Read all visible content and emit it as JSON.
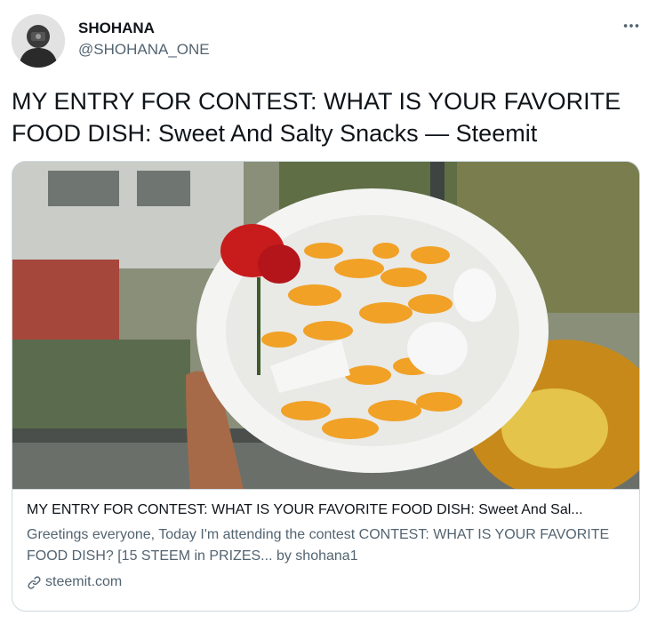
{
  "author": {
    "display_name": "SHOHANA",
    "handle": "@SHOHANA_ONE"
  },
  "tweet": {
    "text": "MY ENTRY FOR CONTEST: WHAT IS YOUR FAVORITE FOOD DISH: Sweet And Salty Snacks — Steemit"
  },
  "card": {
    "title": "MY ENTRY FOR CONTEST: WHAT IS YOUR FAVORITE FOOD DISH: Sweet And Sal...",
    "description": "Greetings everyone, Today I'm attending the contest CONTEST: WHAT IS YOUR FAVORITE FOOD DISH? [15 STEEM in PRIZES... by shohana1",
    "domain": "steemit.com"
  },
  "icons": {
    "more": "more-horizontal-icon",
    "link": "link-icon"
  },
  "colors": {
    "text_primary": "#0f1419",
    "text_secondary": "#536471",
    "border": "#cfd9de"
  }
}
